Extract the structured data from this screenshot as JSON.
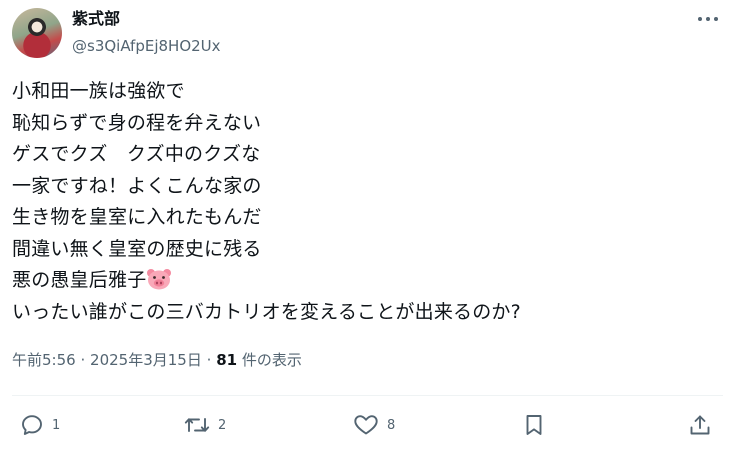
{
  "author": {
    "display_name": "紫式部",
    "handle": "@s3QiAfpEj8HO2Ux"
  },
  "tweet": {
    "lines": [
      "小和田一族は強欲で",
      "恥知らずで身の程を弁えない",
      "ゲスでクズ　クズ中のクズな",
      "一家ですね！よくこんな家の",
      "生き物を皇室に入れたもんだ",
      "間違い無く皇室の歴史に残る",
      "悪の愚皇后雅子",
      "いったい誰がこの三バカトリオを変えることが出来るのか?"
    ],
    "emoji": "pig-face"
  },
  "meta": {
    "time": "午前5:56",
    "separator": "·",
    "date": "2025年3月15日",
    "views_count": "81",
    "views_label": "件の表示"
  },
  "actions": {
    "reply_count": "1",
    "retweet_count": "2",
    "like_count": "8"
  },
  "colors": {
    "text": "#0f1419",
    "secondary": "#536471",
    "divider": "#eff3f4"
  }
}
